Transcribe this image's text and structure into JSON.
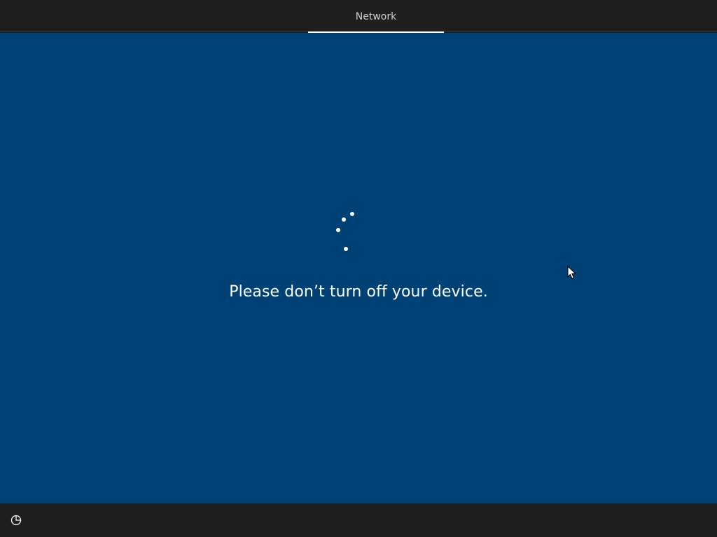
{
  "header": {
    "tab_label": "Network"
  },
  "main": {
    "message": "Please don’t turn off your device."
  },
  "bottom": {
    "accessibility_icon": "accessibility-icon"
  },
  "colors": {
    "background_blue": "#004275",
    "bar_dark": "#1f1f1f",
    "text_light": "#ffffff"
  }
}
